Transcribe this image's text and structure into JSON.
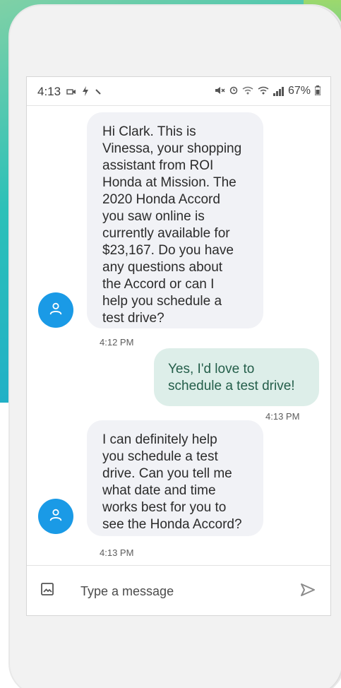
{
  "status_bar": {
    "time": "4:13",
    "battery": "67%",
    "left_icons": [
      "video-camera-icon",
      "charging-bolt-icon",
      "wave-icon"
    ],
    "right_icons": [
      "mute-icon",
      "alarm-icon",
      "wifi-icon",
      "volte-icon",
      "signal-icon",
      "battery-icon"
    ]
  },
  "messages": [
    {
      "sender": "incoming",
      "text": "Hi Clark. This is\nVinessa, your shopping\nassistant from ROI\nHonda at Mission. The\n2020 Honda Accord\nyou saw online is\ncurrently available for\n$23,167. Do you have\nany questions about\nthe Accord or can I\nhelp you schedule a\ntest drive?",
      "time": "4:12 PM",
      "avatar_icon": "person-icon"
    },
    {
      "sender": "outgoing",
      "text": "Yes, I'd love to\nschedule a test drive!",
      "time": "4:13 PM"
    },
    {
      "sender": "incoming",
      "text": "I can definitely help\nyou schedule a test\ndrive. Can you tell me\nwhat date and time\nworks best for you to\nsee the Honda Accord?",
      "time": "4:13 PM",
      "avatar_icon": "person-icon"
    }
  ],
  "composer": {
    "placeholder": "Type a message",
    "attach_icon": "image-icon",
    "send_icon": "send-icon"
  },
  "colors": {
    "avatar": "#1a9ae6",
    "incoming_bubble": "#f1f2f6",
    "outgoing_bubble": "#ddeee9",
    "outgoing_text": "#245e4a"
  }
}
